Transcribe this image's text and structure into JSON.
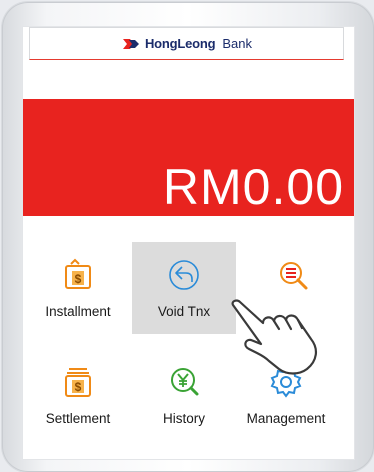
{
  "header": {
    "brand_bold": "HongLeong",
    "brand_light": "Bank"
  },
  "amount": {
    "value": "RM0.00"
  },
  "menu": {
    "items": [
      {
        "label": "Installment",
        "icon": "installment-dollar-icon"
      },
      {
        "label": "Void Tnx",
        "icon": "void-back-arrow-icon"
      },
      {
        "label": "",
        "icon": "list-search-icon"
      },
      {
        "label": "Settlement",
        "icon": "settlement-dollar-icon"
      },
      {
        "label": "History",
        "icon": "history-yen-icon"
      },
      {
        "label": "Management",
        "icon": "gear-icon"
      }
    ]
  },
  "colors": {
    "accent": "#e8231f",
    "brand_navy": "#1b2c6b",
    "icon_orange": "#f08a16",
    "icon_green": "#3aa335",
    "icon_blue": "#2a8bd8",
    "selected_bg": "#dcdcdc"
  }
}
